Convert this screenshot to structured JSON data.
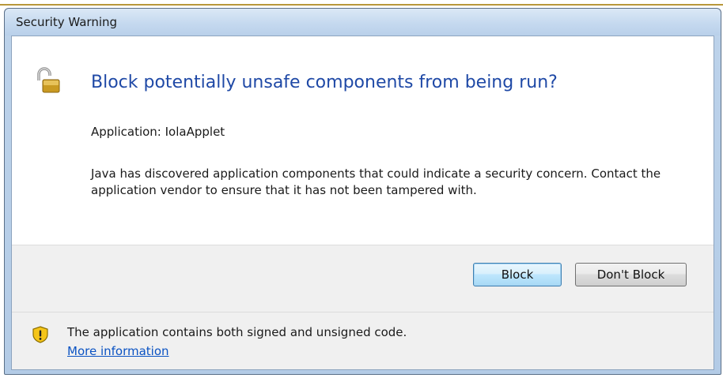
{
  "window": {
    "title": "Security Warning"
  },
  "dialog": {
    "heading": "Block potentially unsafe components from being run?",
    "application_line": "Application: IolaApplet",
    "description": "Java has discovered application components that could indicate a security concern. Contact the application vendor to ensure that it has not been tampered with."
  },
  "buttons": {
    "block_label": "Block",
    "dont_block_label": "Don't Block"
  },
  "footer": {
    "message": "The application contains both signed and unsigned code.",
    "more_info_link": "More information"
  },
  "icons": {
    "lock": "unlocked-padlock-icon",
    "warning": "warning-shield-icon"
  },
  "colors": {
    "heading": "#1f49a6",
    "link": "#0b53c3",
    "accent_rule": "#b8973a"
  }
}
